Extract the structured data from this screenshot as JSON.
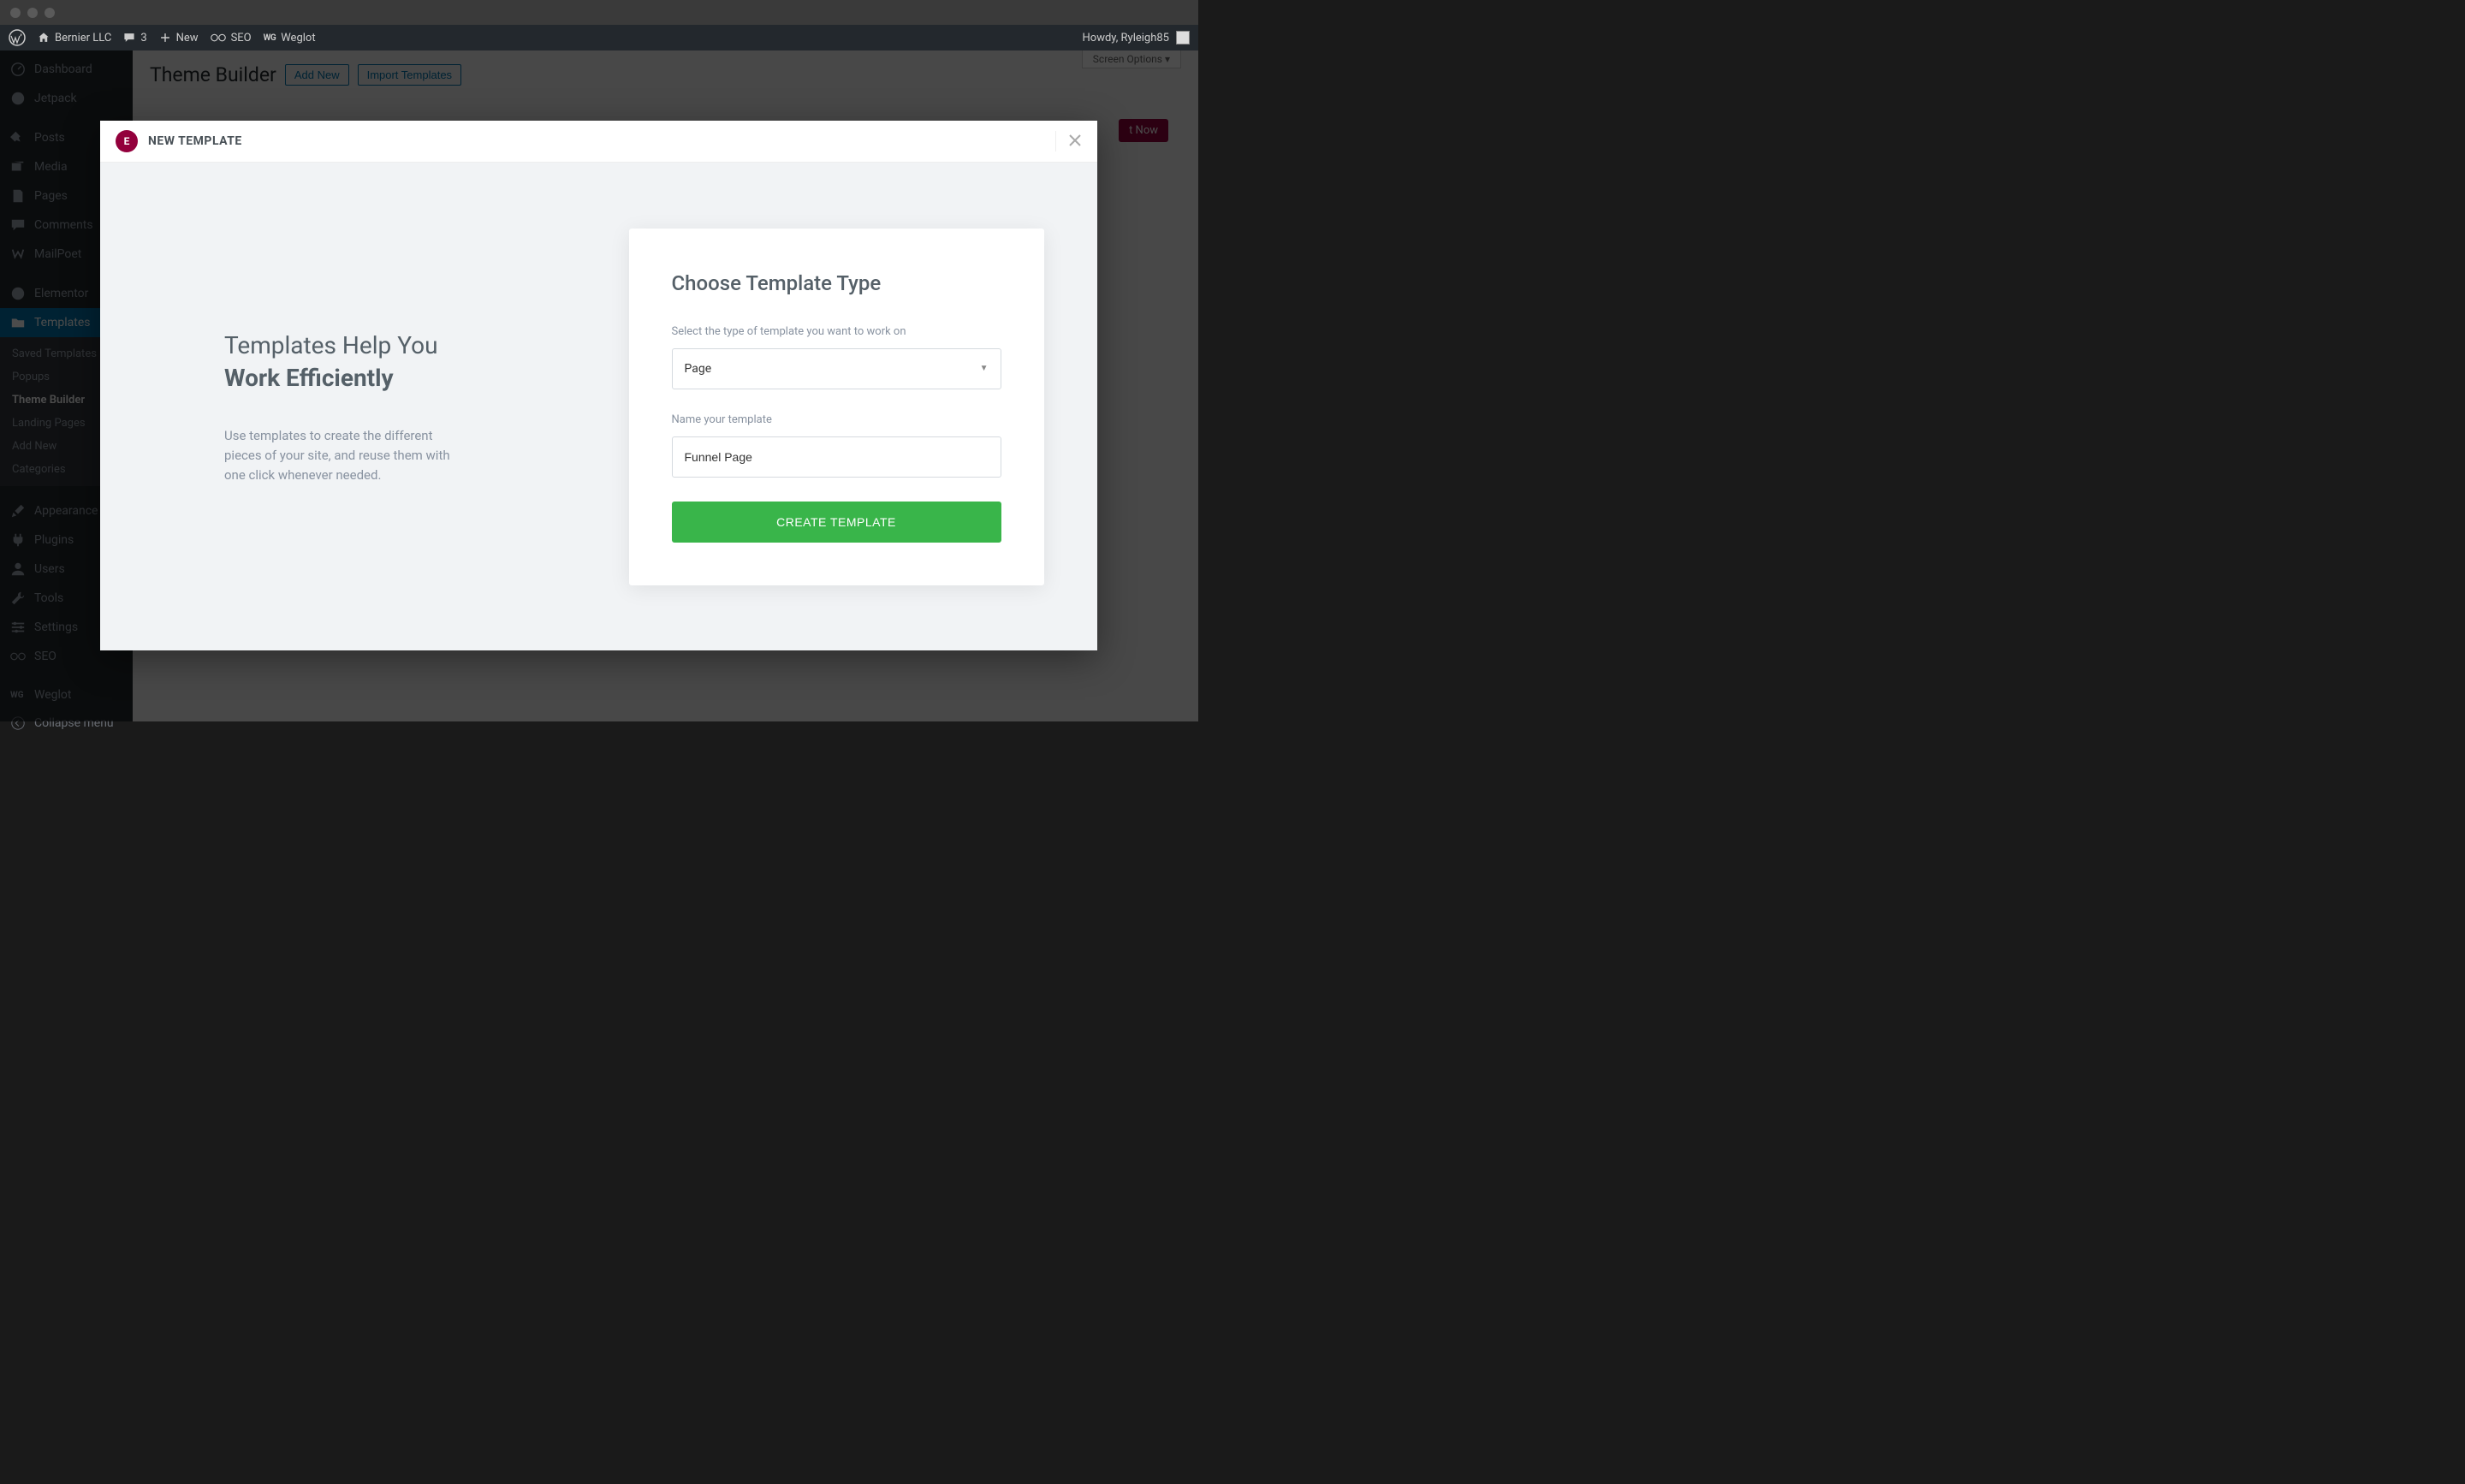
{
  "adminbar": {
    "site_name": "Bernier LLC",
    "comments_count": "3",
    "new_label": "New",
    "seo_label": "SEO",
    "weglot_label": "Weglot",
    "howdy": "Howdy, Ryleigh85"
  },
  "sidebar": {
    "dashboard": "Dashboard",
    "jetpack": "Jetpack",
    "posts": "Posts",
    "media": "Media",
    "pages": "Pages",
    "comments": "Comments",
    "mailpoet": "MailPoet",
    "elementor": "Elementor",
    "templates": "Templates",
    "sub": {
      "saved": "Saved Templates",
      "popups": "Popups",
      "theme_builder": "Theme Builder",
      "landing": "Landing Pages",
      "add_new": "Add New",
      "categories": "Categories"
    },
    "appearance": "Appearance",
    "plugins": "Plugins",
    "users": "Users",
    "tools": "Tools",
    "settings": "Settings",
    "seo": "SEO",
    "weglot": "Weglot",
    "collapse": "Collapse menu"
  },
  "page": {
    "title": "Theme Builder",
    "add_new": "Add New",
    "import": "Import Templates",
    "screen_options": "Screen Options ▾",
    "it_now": "t Now"
  },
  "modal": {
    "header": "NEW TEMPLATE",
    "headline1": "Templates Help You",
    "headline2": "Work Efficiently",
    "subtext": "Use templates to create the different pieces of your site, and reuse them with one click whenever needed.",
    "form_title": "Choose Template Type",
    "type_label": "Select the type of template you want to work on",
    "type_value": "Page",
    "name_label": "Name your template",
    "name_value": "Funnel Page",
    "submit": "CREATE TEMPLATE"
  }
}
